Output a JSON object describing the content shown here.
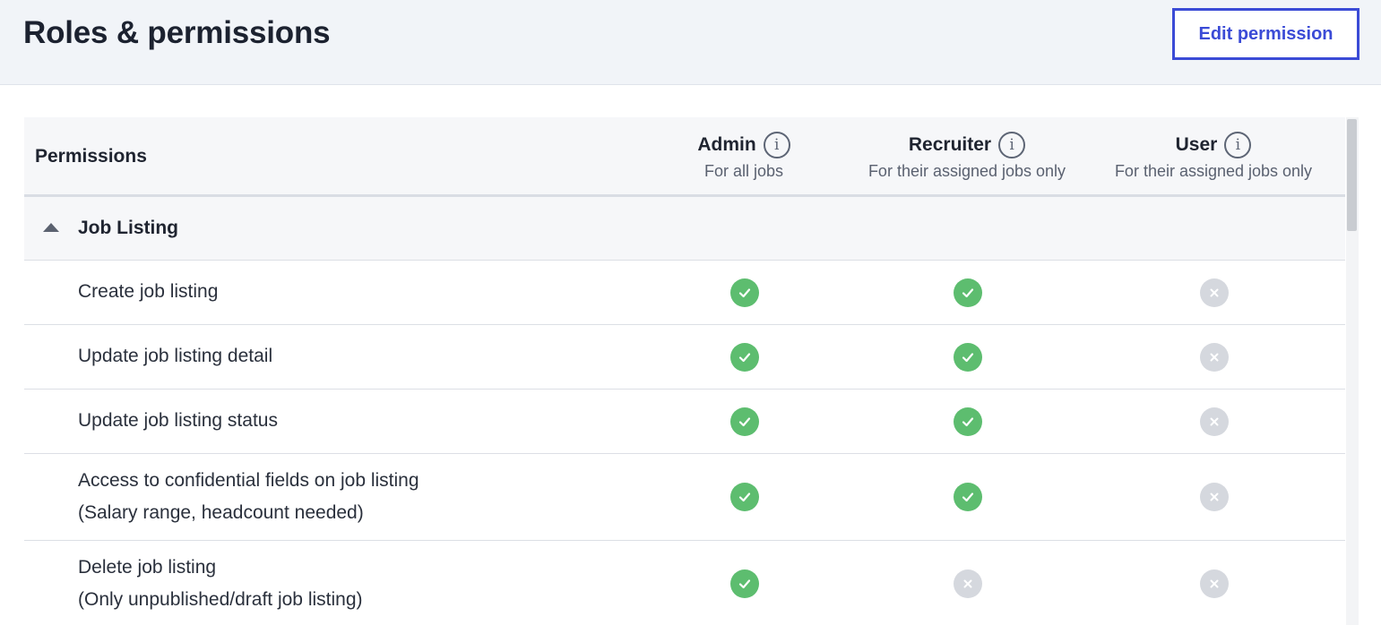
{
  "header": {
    "title": "Roles & permissions",
    "edit_button_label": "Edit permission"
  },
  "table": {
    "permissions_header": "Permissions",
    "roles": [
      {
        "name": "Admin",
        "scope": "For all jobs"
      },
      {
        "name": "Recruiter",
        "scope": "For their assigned jobs only"
      },
      {
        "name": "User",
        "scope": "For their assigned jobs only"
      }
    ],
    "section": {
      "label": "Job Listing",
      "expanded": true
    },
    "rows": [
      {
        "label": "Create job listing",
        "sublabel": "",
        "admin": "allowed",
        "recruiter": "allowed",
        "user": "denied"
      },
      {
        "label": "Update job listing detail",
        "sublabel": "",
        "admin": "allowed",
        "recruiter": "allowed",
        "user": "denied"
      },
      {
        "label": "Update job listing status",
        "sublabel": "",
        "admin": "allowed",
        "recruiter": "allowed",
        "user": "denied"
      },
      {
        "label": "Access to confidential fields on job listing",
        "sublabel": "(Salary range, headcount needed)",
        "admin": "allowed",
        "recruiter": "allowed",
        "user": "denied"
      },
      {
        "label": "Delete job listing",
        "sublabel": "(Only unpublished/draft job listing)",
        "admin": "allowed",
        "recruiter": "denied",
        "user": "denied"
      }
    ]
  },
  "colors": {
    "accent": "#3b4bd6",
    "allowed": "#5dbd6f",
    "denied": "#d5d8de"
  },
  "icons": {
    "allowed": "check-circle-icon",
    "denied": "x-circle-icon",
    "info": "info-icon",
    "collapse": "caret-up-icon"
  }
}
